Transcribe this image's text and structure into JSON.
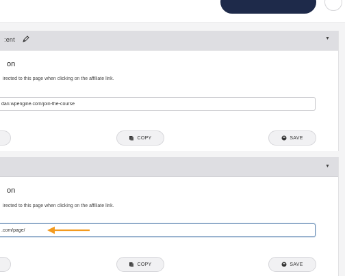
{
  "panels": [
    {
      "header_title": ":ent",
      "section_title": "on",
      "description": "irected to this page when clicking on the affiliate link.",
      "input_value": "dari.wpengine.com/join-the-course",
      "copy_label": "COPY",
      "save_label": "SAVE"
    },
    {
      "header_title": "",
      "section_title": "on",
      "description": "irected to this page when clicking on the affiliate link.",
      "input_value": ".com/page/",
      "copy_label": "COPY",
      "save_label": "SAVE"
    }
  ],
  "icons": {
    "edit": "pencil-icon",
    "collapse": "caret-down-icon",
    "copy": "clipboard-icon",
    "save": "disk-icon",
    "annotation": "arrow-left-icon"
  },
  "colors": {
    "accent_dark": "#1e2a4a",
    "annotation_arrow": "#f39a1e",
    "active_input_border": "#6a8fb8"
  }
}
